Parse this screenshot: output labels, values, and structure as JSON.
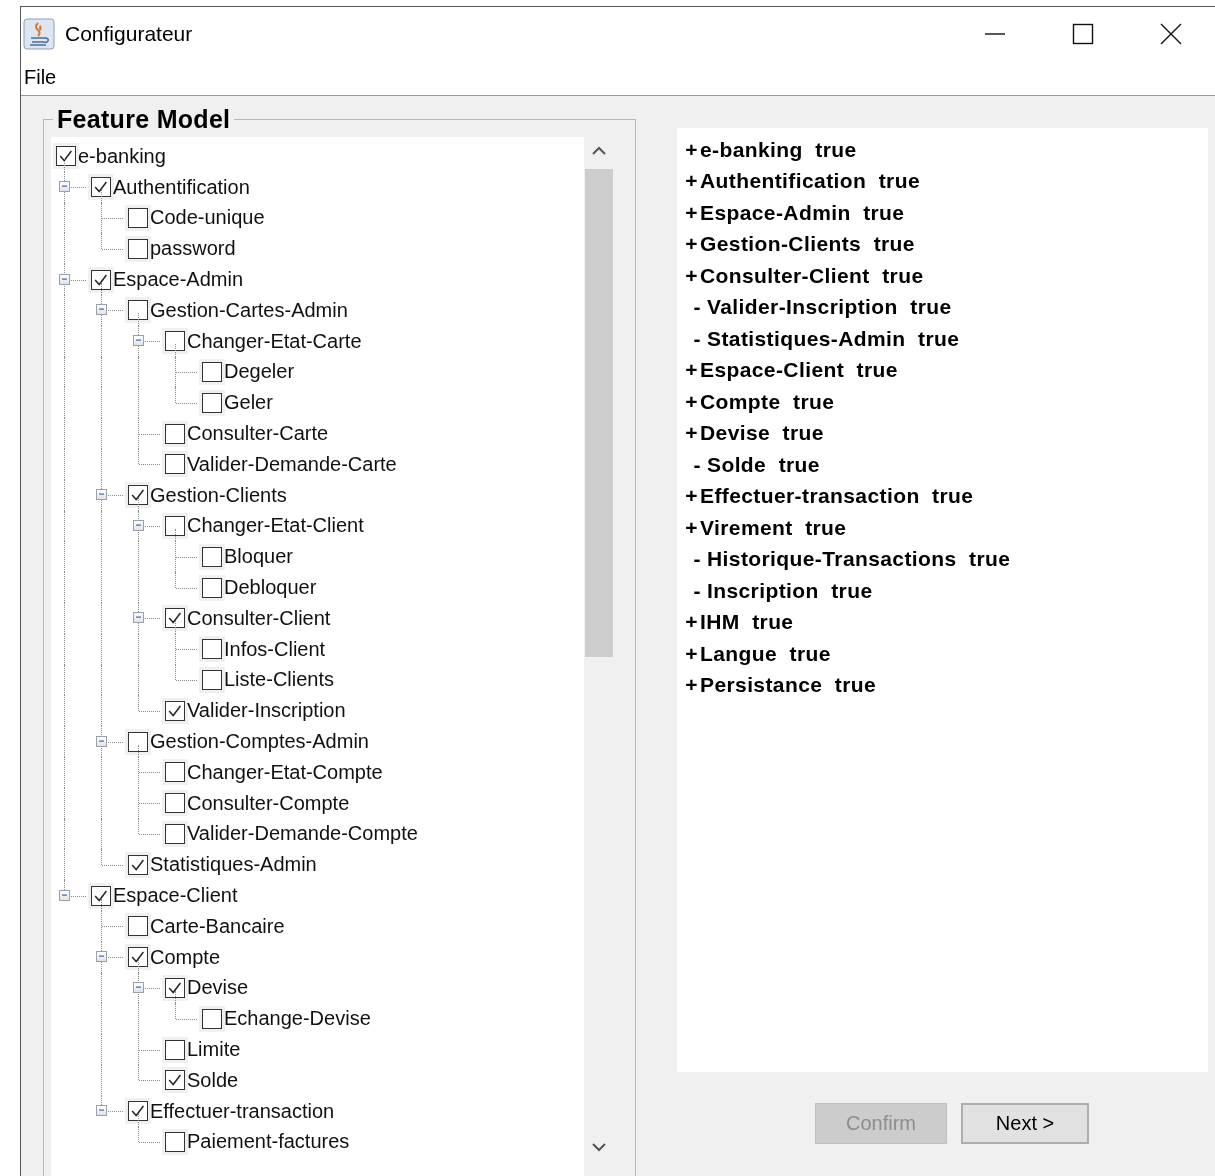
{
  "window": {
    "title": "Configurateur"
  },
  "menu": [
    "File"
  ],
  "feature_model": {
    "title": "Feature Model",
    "tree": [
      {
        "label": "e-banking",
        "checked": true,
        "children": [
          {
            "label": "Authentification",
            "checked": true,
            "expanded": true,
            "children": [
              {
                "label": "Code-unique",
                "checked": false
              },
              {
                "label": "password",
                "checked": false
              }
            ]
          },
          {
            "label": "Espace-Admin",
            "checked": true,
            "expanded": true,
            "children": [
              {
                "label": "Gestion-Cartes-Admin",
                "checked": false,
                "expanded": true,
                "children": [
                  {
                    "label": "Changer-Etat-Carte",
                    "checked": false,
                    "expanded": true,
                    "children": [
                      {
                        "label": "Degeler",
                        "checked": false
                      },
                      {
                        "label": "Geler",
                        "checked": false
                      }
                    ]
                  },
                  {
                    "label": "Consulter-Carte",
                    "checked": false
                  },
                  {
                    "label": "Valider-Demande-Carte",
                    "checked": false
                  }
                ]
              },
              {
                "label": "Gestion-Clients",
                "checked": true,
                "expanded": true,
                "children": [
                  {
                    "label": "Changer-Etat-Client",
                    "checked": false,
                    "expanded": true,
                    "children": [
                      {
                        "label": "Bloquer",
                        "checked": false
                      },
                      {
                        "label": "Debloquer",
                        "checked": false
                      }
                    ]
                  },
                  {
                    "label": "Consulter-Client",
                    "checked": true,
                    "expanded": true,
                    "children": [
                      {
                        "label": "Infos-Client",
                        "checked": false
                      },
                      {
                        "label": "Liste-Clients",
                        "checked": false
                      }
                    ]
                  },
                  {
                    "label": "Valider-Inscription",
                    "checked": true
                  }
                ]
              },
              {
                "label": "Gestion-Comptes-Admin",
                "checked": false,
                "expanded": true,
                "children": [
                  {
                    "label": "Changer-Etat-Compte",
                    "checked": false
                  },
                  {
                    "label": "Consulter-Compte",
                    "checked": false
                  },
                  {
                    "label": "Valider-Demande-Compte",
                    "checked": false
                  }
                ]
              },
              {
                "label": "Statistiques-Admin",
                "checked": true
              }
            ]
          },
          {
            "label": "Espace-Client",
            "checked": true,
            "expanded": true,
            "children": [
              {
                "label": "Carte-Bancaire",
                "checked": false
              },
              {
                "label": "Compte",
                "checked": true,
                "expanded": true,
                "children": [
                  {
                    "label": "Devise",
                    "checked": true,
                    "expanded": true,
                    "children": [
                      {
                        "label": "Echange-Devise",
                        "checked": false
                      }
                    ]
                  },
                  {
                    "label": "Limite",
                    "checked": false
                  },
                  {
                    "label": "Solde",
                    "checked": true
                  }
                ]
              },
              {
                "label": "Effectuer-transaction",
                "checked": true,
                "expanded": true,
                "children": [
                  {
                    "label": "Paiement-factures",
                    "checked": false
                  }
                ]
              }
            ]
          }
        ]
      }
    ]
  },
  "summary": [
    {
      "marker": "+",
      "text": "e-banking  true"
    },
    {
      "marker": "+",
      "text": "Authentification  true"
    },
    {
      "marker": "+",
      "text": "Espace-Admin  true"
    },
    {
      "marker": "+",
      "text": "Gestion-Clients  true"
    },
    {
      "marker": "+",
      "text": "Consulter-Client  true"
    },
    {
      "marker": "-",
      "text": "Valider-Inscription  true"
    },
    {
      "marker": "-",
      "text": "Statistiques-Admin  true"
    },
    {
      "marker": "+",
      "text": "Espace-Client  true"
    },
    {
      "marker": "+",
      "text": "Compte  true"
    },
    {
      "marker": "+",
      "text": "Devise  true"
    },
    {
      "marker": "-",
      "text": "Solde  true"
    },
    {
      "marker": "+",
      "text": "Effectuer-transaction  true"
    },
    {
      "marker": "+",
      "text": "Virement  true"
    },
    {
      "marker": "-",
      "text": "Historique-Transactions  true"
    },
    {
      "marker": "-",
      "text": "Inscription  true"
    },
    {
      "marker": "+",
      "text": "IHM  true"
    },
    {
      "marker": "+",
      "text": "Langue  true"
    },
    {
      "marker": "+",
      "text": "Persistance  true"
    }
  ],
  "buttons": [
    {
      "label": "Confirm",
      "disabled": true
    },
    {
      "label": "Next >",
      "disabled": false
    }
  ]
}
